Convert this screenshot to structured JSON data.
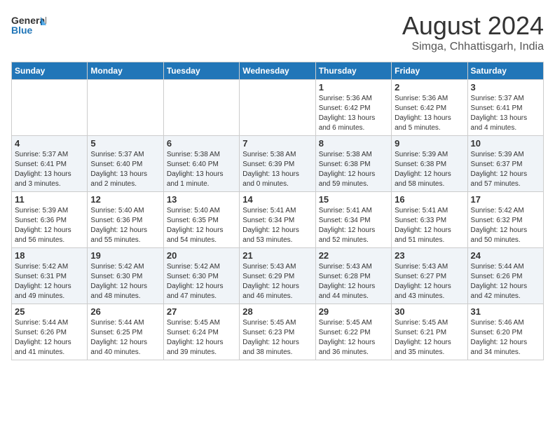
{
  "header": {
    "logo_general": "General",
    "logo_blue": "Blue",
    "title": "August 2024",
    "subtitle": "Simga, Chhattisgarh, India"
  },
  "weekdays": [
    "Sunday",
    "Monday",
    "Tuesday",
    "Wednesday",
    "Thursday",
    "Friday",
    "Saturday"
  ],
  "weeks": [
    [
      {
        "day": "",
        "info": ""
      },
      {
        "day": "",
        "info": ""
      },
      {
        "day": "",
        "info": ""
      },
      {
        "day": "",
        "info": ""
      },
      {
        "day": "1",
        "info": "Sunrise: 5:36 AM\nSunset: 6:42 PM\nDaylight: 13 hours\nand 6 minutes."
      },
      {
        "day": "2",
        "info": "Sunrise: 5:36 AM\nSunset: 6:42 PM\nDaylight: 13 hours\nand 5 minutes."
      },
      {
        "day": "3",
        "info": "Sunrise: 5:37 AM\nSunset: 6:41 PM\nDaylight: 13 hours\nand 4 minutes."
      }
    ],
    [
      {
        "day": "4",
        "info": "Sunrise: 5:37 AM\nSunset: 6:41 PM\nDaylight: 13 hours\nand 3 minutes."
      },
      {
        "day": "5",
        "info": "Sunrise: 5:37 AM\nSunset: 6:40 PM\nDaylight: 13 hours\nand 2 minutes."
      },
      {
        "day": "6",
        "info": "Sunrise: 5:38 AM\nSunset: 6:40 PM\nDaylight: 13 hours\nand 1 minute."
      },
      {
        "day": "7",
        "info": "Sunrise: 5:38 AM\nSunset: 6:39 PM\nDaylight: 13 hours\nand 0 minutes."
      },
      {
        "day": "8",
        "info": "Sunrise: 5:38 AM\nSunset: 6:38 PM\nDaylight: 12 hours\nand 59 minutes."
      },
      {
        "day": "9",
        "info": "Sunrise: 5:39 AM\nSunset: 6:38 PM\nDaylight: 12 hours\nand 58 minutes."
      },
      {
        "day": "10",
        "info": "Sunrise: 5:39 AM\nSunset: 6:37 PM\nDaylight: 12 hours\nand 57 minutes."
      }
    ],
    [
      {
        "day": "11",
        "info": "Sunrise: 5:39 AM\nSunset: 6:36 PM\nDaylight: 12 hours\nand 56 minutes."
      },
      {
        "day": "12",
        "info": "Sunrise: 5:40 AM\nSunset: 6:36 PM\nDaylight: 12 hours\nand 55 minutes."
      },
      {
        "day": "13",
        "info": "Sunrise: 5:40 AM\nSunset: 6:35 PM\nDaylight: 12 hours\nand 54 minutes."
      },
      {
        "day": "14",
        "info": "Sunrise: 5:41 AM\nSunset: 6:34 PM\nDaylight: 12 hours\nand 53 minutes."
      },
      {
        "day": "15",
        "info": "Sunrise: 5:41 AM\nSunset: 6:34 PM\nDaylight: 12 hours\nand 52 minutes."
      },
      {
        "day": "16",
        "info": "Sunrise: 5:41 AM\nSunset: 6:33 PM\nDaylight: 12 hours\nand 51 minutes."
      },
      {
        "day": "17",
        "info": "Sunrise: 5:42 AM\nSunset: 6:32 PM\nDaylight: 12 hours\nand 50 minutes."
      }
    ],
    [
      {
        "day": "18",
        "info": "Sunrise: 5:42 AM\nSunset: 6:31 PM\nDaylight: 12 hours\nand 49 minutes."
      },
      {
        "day": "19",
        "info": "Sunrise: 5:42 AM\nSunset: 6:30 PM\nDaylight: 12 hours\nand 48 minutes."
      },
      {
        "day": "20",
        "info": "Sunrise: 5:42 AM\nSunset: 6:30 PM\nDaylight: 12 hours\nand 47 minutes."
      },
      {
        "day": "21",
        "info": "Sunrise: 5:43 AM\nSunset: 6:29 PM\nDaylight: 12 hours\nand 46 minutes."
      },
      {
        "day": "22",
        "info": "Sunrise: 5:43 AM\nSunset: 6:28 PM\nDaylight: 12 hours\nand 44 minutes."
      },
      {
        "day": "23",
        "info": "Sunrise: 5:43 AM\nSunset: 6:27 PM\nDaylight: 12 hours\nand 43 minutes."
      },
      {
        "day": "24",
        "info": "Sunrise: 5:44 AM\nSunset: 6:26 PM\nDaylight: 12 hours\nand 42 minutes."
      }
    ],
    [
      {
        "day": "25",
        "info": "Sunrise: 5:44 AM\nSunset: 6:26 PM\nDaylight: 12 hours\nand 41 minutes."
      },
      {
        "day": "26",
        "info": "Sunrise: 5:44 AM\nSunset: 6:25 PM\nDaylight: 12 hours\nand 40 minutes."
      },
      {
        "day": "27",
        "info": "Sunrise: 5:45 AM\nSunset: 6:24 PM\nDaylight: 12 hours\nand 39 minutes."
      },
      {
        "day": "28",
        "info": "Sunrise: 5:45 AM\nSunset: 6:23 PM\nDaylight: 12 hours\nand 38 minutes."
      },
      {
        "day": "29",
        "info": "Sunrise: 5:45 AM\nSunset: 6:22 PM\nDaylight: 12 hours\nand 36 minutes."
      },
      {
        "day": "30",
        "info": "Sunrise: 5:45 AM\nSunset: 6:21 PM\nDaylight: 12 hours\nand 35 minutes."
      },
      {
        "day": "31",
        "info": "Sunrise: 5:46 AM\nSunset: 6:20 PM\nDaylight: 12 hours\nand 34 minutes."
      }
    ]
  ]
}
